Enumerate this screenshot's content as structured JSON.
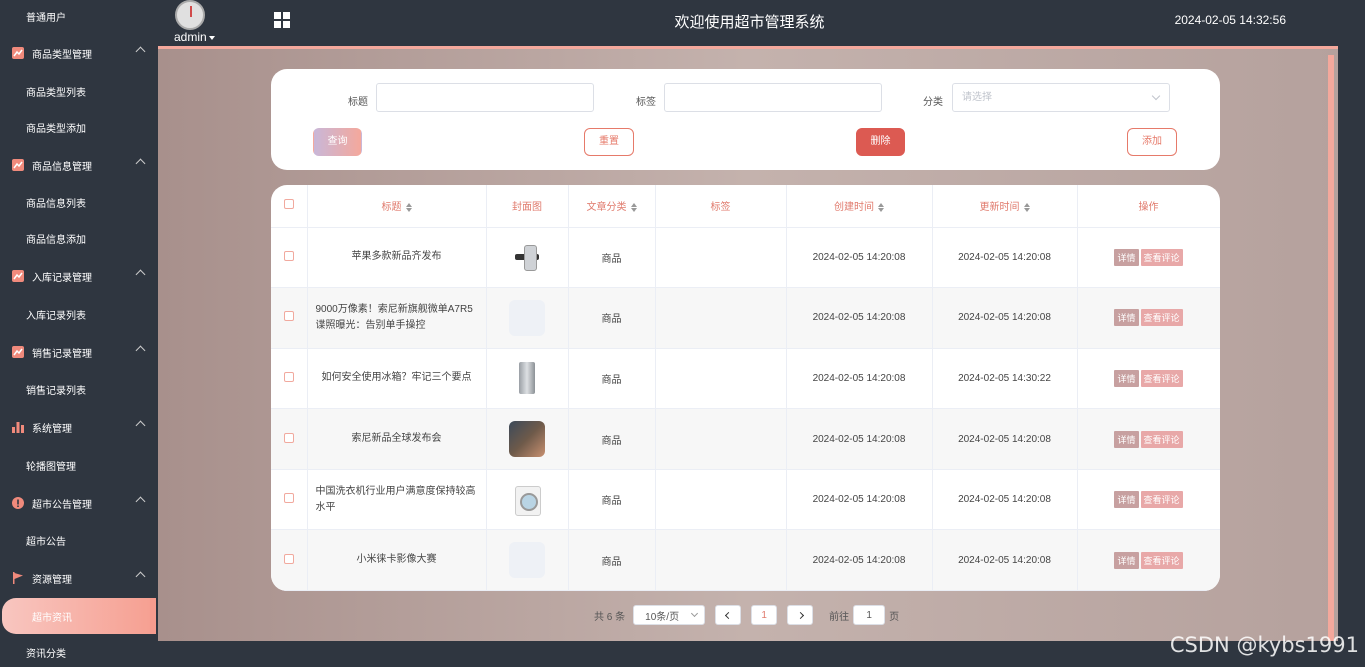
{
  "app": {
    "title": "欢迎使用超市管理系统",
    "datetime": "2024-02-05 14:32:56",
    "user": "admin"
  },
  "sidebar": {
    "top_item": "普通用户",
    "groups": [
      {
        "label": "商品类型管理",
        "icon": "chart-icon",
        "items": [
          "商品类型列表",
          "商品类型添加"
        ]
      },
      {
        "label": "商品信息管理",
        "icon": "chart-icon",
        "items": [
          "商品信息列表",
          "商品信息添加"
        ]
      },
      {
        "label": "入库记录管理",
        "icon": "chart-icon",
        "items": [
          "入库记录列表"
        ]
      },
      {
        "label": "销售记录管理",
        "icon": "chart-icon",
        "items": [
          "销售记录列表"
        ]
      },
      {
        "label": "系统管理",
        "icon": "bar-chart-icon",
        "items": [
          "轮播图管理"
        ]
      },
      {
        "label": "超市公告管理",
        "icon": "info-icon",
        "items": [
          "超市公告"
        ]
      },
      {
        "label": "资源管理",
        "icon": "flag-icon",
        "items": [
          "超市资讯",
          "资讯分类"
        ]
      }
    ],
    "active_item": "超市资讯"
  },
  "search": {
    "title_label": "标题",
    "tag_label": "标签",
    "category_label": "分类",
    "category_placeholder": "请选择",
    "query_btn": "查询",
    "reset_btn": "重置",
    "delete_btn": "删除",
    "add_btn": "添加"
  },
  "table": {
    "headers": {
      "title": "标题",
      "cover": "封面图",
      "category": "文章分类",
      "tag": "标签",
      "created": "创建时间",
      "updated": "更新时间",
      "actions": "操作"
    },
    "rows": [
      {
        "title": "苹果多款新品齐发布",
        "cover": "watch",
        "category": "商品",
        "tag": "",
        "created": "2024-02-05 14:20:08",
        "updated": "2024-02-05 14:20:08"
      },
      {
        "title": "9000万像素！索尼新旗舰微单A7R5谍照曝光：告别单手操控",
        "cover": "blank",
        "category": "商品",
        "tag": "",
        "created": "2024-02-05 14:20:08",
        "updated": "2024-02-05 14:20:08"
      },
      {
        "title": "如何安全使用冰箱？牢记三个要点",
        "cover": "fridge",
        "category": "商品",
        "tag": "",
        "created": "2024-02-05 14:20:08",
        "updated": "2024-02-05 14:30:22"
      },
      {
        "title": "索尼新品全球发布会",
        "cover": "photo",
        "category": "商品",
        "tag": "",
        "created": "2024-02-05 14:20:08",
        "updated": "2024-02-05 14:20:08"
      },
      {
        "title": "中国洗衣机行业用户满意度保持较高水平",
        "cover": "washer",
        "category": "商品",
        "tag": "",
        "created": "2024-02-05 14:20:08",
        "updated": "2024-02-05 14:20:08"
      },
      {
        "title": "小米徕卡影像大赛",
        "cover": "blank",
        "category": "商品",
        "tag": "",
        "created": "2024-02-05 14:20:08",
        "updated": "2024-02-05 14:20:08"
      }
    ],
    "detail_btn": "详情",
    "comment_btn": "查看评论"
  },
  "pager": {
    "total": "共 6 条",
    "page_size": "10条/页",
    "current_page": "1",
    "goto": "前往",
    "goto_value": "1",
    "page_unit": "页"
  },
  "watermark": "CSDN @kybs1991",
  "colors": {
    "accent": "#e07a6c",
    "sidebar": "#2f3640",
    "danger": "#dc5a52"
  }
}
